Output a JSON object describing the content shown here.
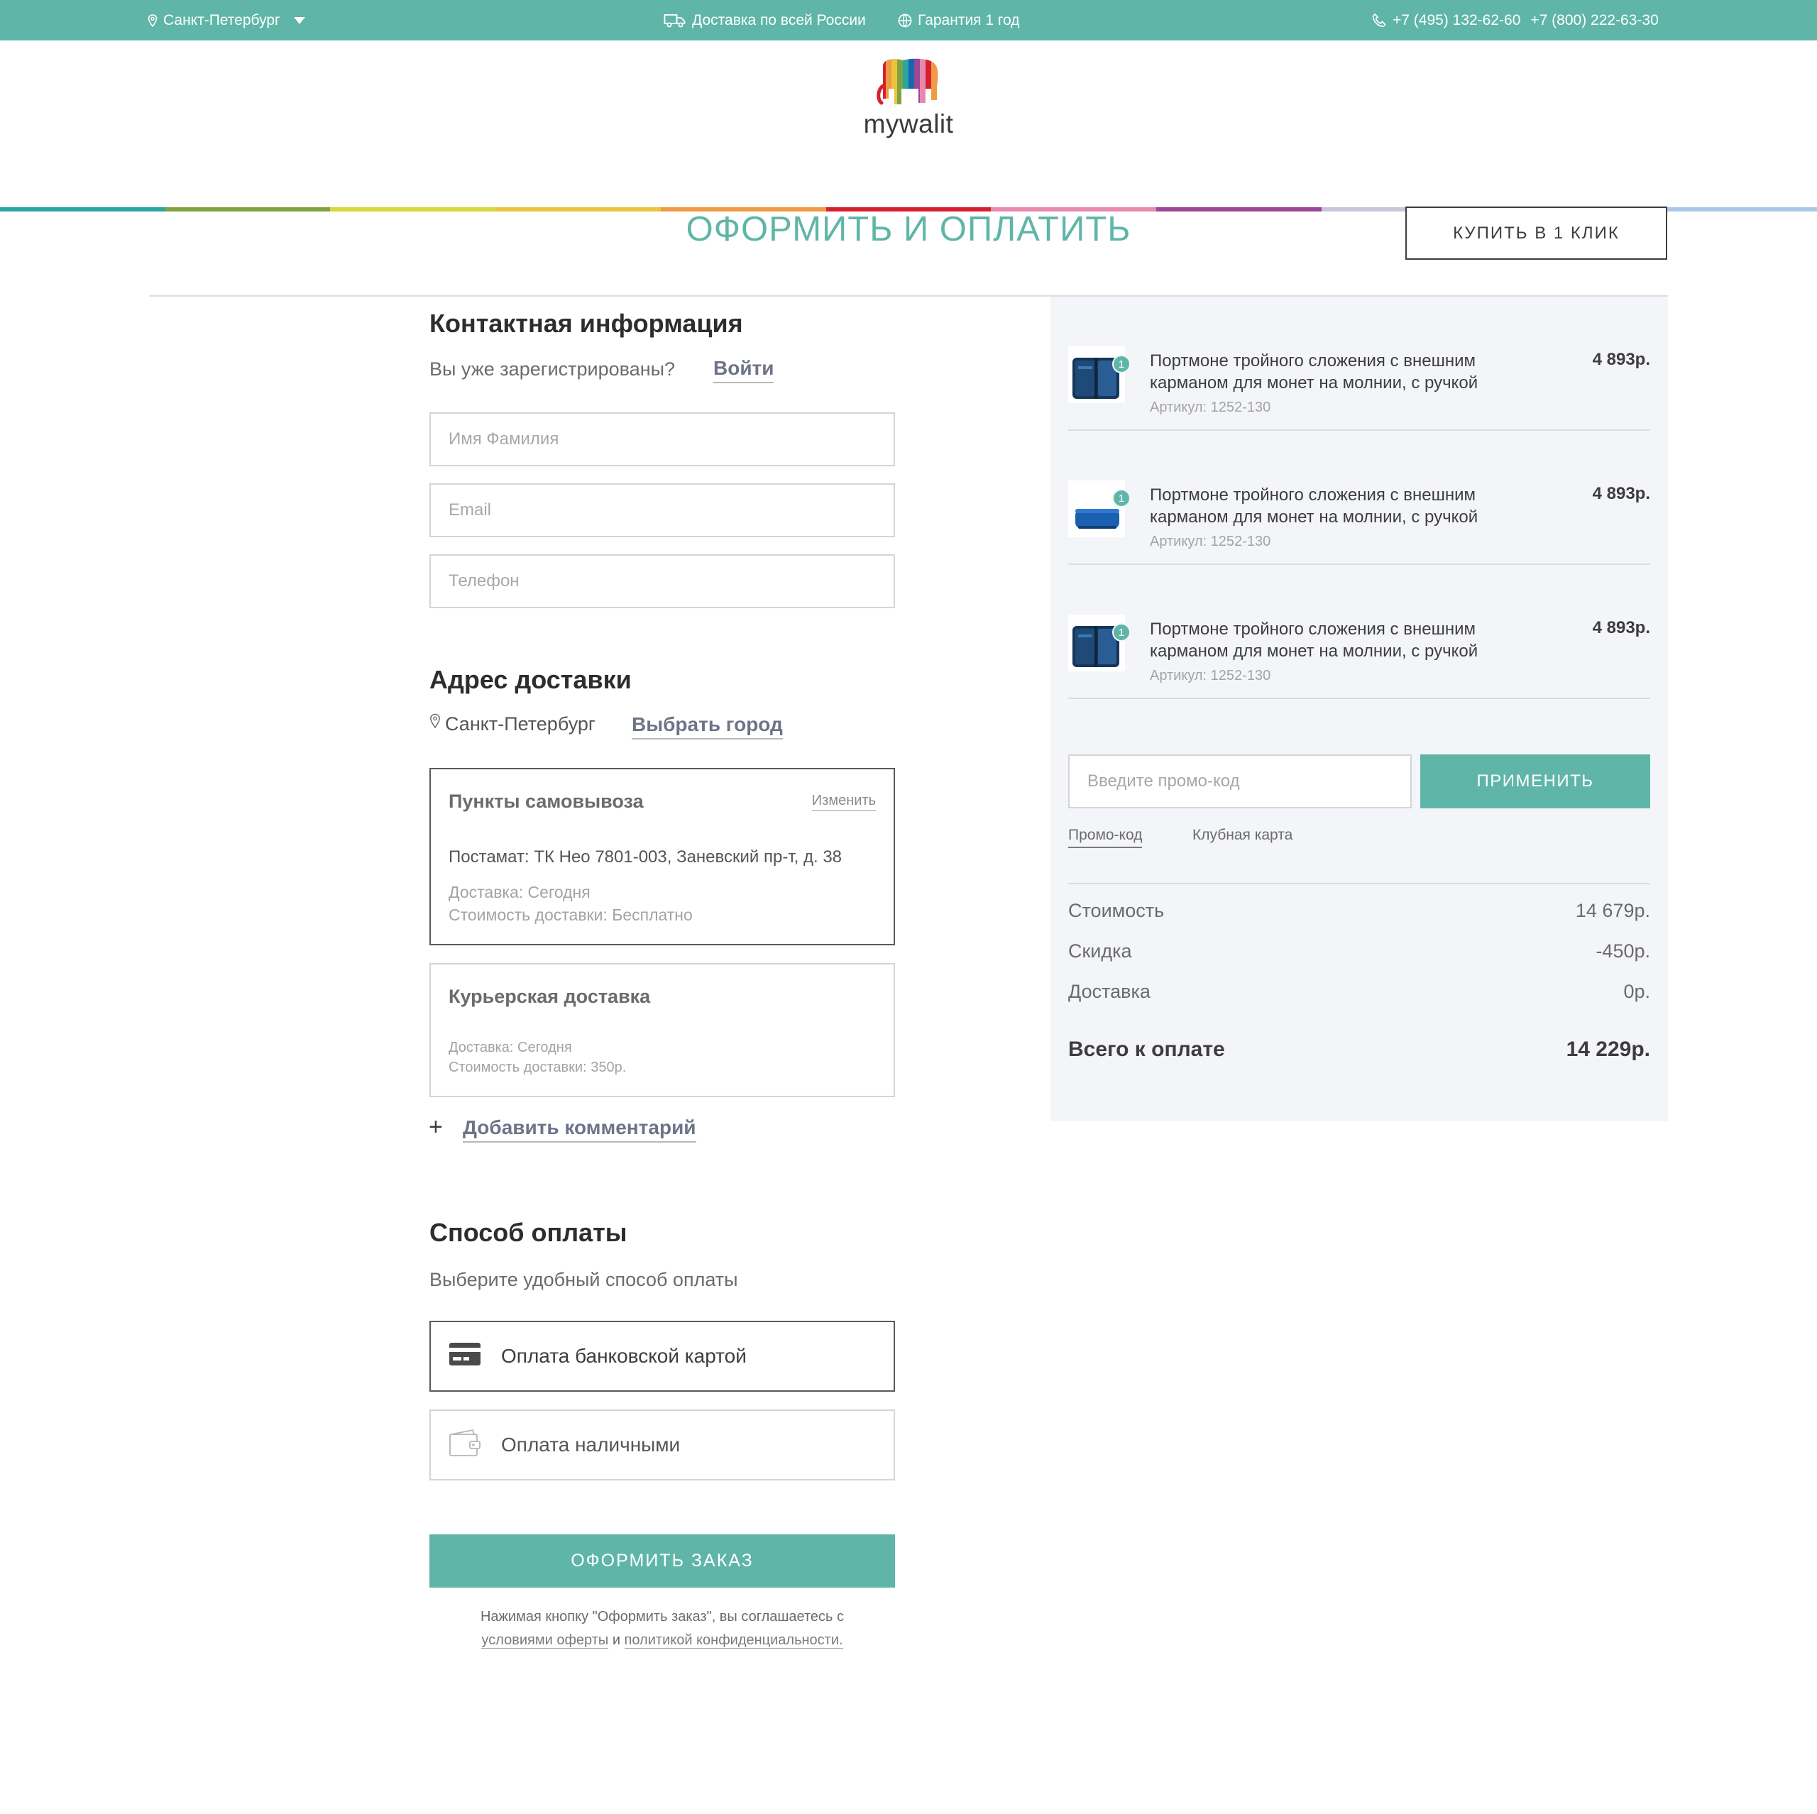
{
  "topbar": {
    "city": "Санкт-Петербург",
    "delivery": "Доставка по всей России",
    "warranty": "Гарантия 1 год",
    "phone1": "+7 (495) 132-62-60",
    "phone2": "+7 (800) 222-63-30"
  },
  "header": {
    "logo_text": "mywalit",
    "stripe_colors": [
      "#2aa6a3",
      "#7fa33e",
      "#d6d83b",
      "#eac43d",
      "#ef9a44",
      "#d6202e",
      "#e789ae",
      "#9a4796",
      "#c8c5dc",
      "#1a65ad",
      "#a9c8e8"
    ]
  },
  "page": {
    "title": "ОФОРМИТЬ И ОПЛАТИТЬ",
    "one_click": "КУПИТЬ В 1 КЛИК"
  },
  "contact": {
    "heading": "Контактная информация",
    "registered": "Вы уже зарегистрированы?",
    "login": "Войти",
    "name_placeholder": "Имя Фамилия",
    "email_placeholder": "Email",
    "phone_placeholder": "Телефон"
  },
  "address": {
    "heading": "Адрес доставки",
    "city": "Санкт-Петербург",
    "choose_city": "Выбрать город",
    "pickup": {
      "title": "Пункты самовывоза",
      "change": "Изменить",
      "point": "Постамат: ТК Нео 7801-003, Заневский пр-т, д. 38",
      "when": "Доставка: Сегодня",
      "cost": "Стоимость доставки: Бесплатно"
    },
    "courier": {
      "title": "Курьерская доставка",
      "when": "Доставка: Сегодня",
      "cost": "Стоимость доставки: 350р."
    },
    "add_comment": "Добавить комментарий"
  },
  "payment": {
    "heading": "Способ оплаты",
    "subtitle": "Выберите удобный способ оплаты",
    "card": "Оплата банковской картой",
    "cash": "Оплата наличными"
  },
  "submit": {
    "label": "ОФОРМИТЬ ЗАКАЗ",
    "legal_1": "Нажимая кнопку \"Оформить заказ\", вы соглашаетесь с",
    "legal_link1": "условиями оферты",
    "legal_and": "и",
    "legal_link2": "политикой конфиденциальности."
  },
  "cart": {
    "items": [
      {
        "qty": "1",
        "name": "Портмоне тройного сложения с внешним карманом для монет на молнии, с ручкой",
        "article": "Артикул: 1252-130",
        "price": "4 893р."
      },
      {
        "qty": "1",
        "name": "Портмоне тройного сложения с внешним карманом для монет на молнии, с ручкой",
        "article": "Артикул: 1252-130",
        "price": "4 893р."
      },
      {
        "qty": "1",
        "name": "Портмоне тройного сложения с внешним карманом для монет на молнии, с ручкой",
        "article": "Артикул: 1252-130",
        "price": "4 893р."
      }
    ],
    "promo_placeholder": "Введите промо-код",
    "apply": "ПРИМЕНИТЬ",
    "tab_promo": "Промо-код",
    "tab_club": "Клубная карта",
    "cost_label": "Стоимость",
    "cost_value": "14 679р.",
    "discount_label": "Скидка",
    "discount_value": "-450р.",
    "delivery_label": "Доставка",
    "delivery_value": "0р.",
    "total_label": "Всего к оплате",
    "total_value": "14 229р."
  },
  "colors": {
    "accent": "#5fb6a8",
    "summary_bg": "#f4f5f8"
  }
}
